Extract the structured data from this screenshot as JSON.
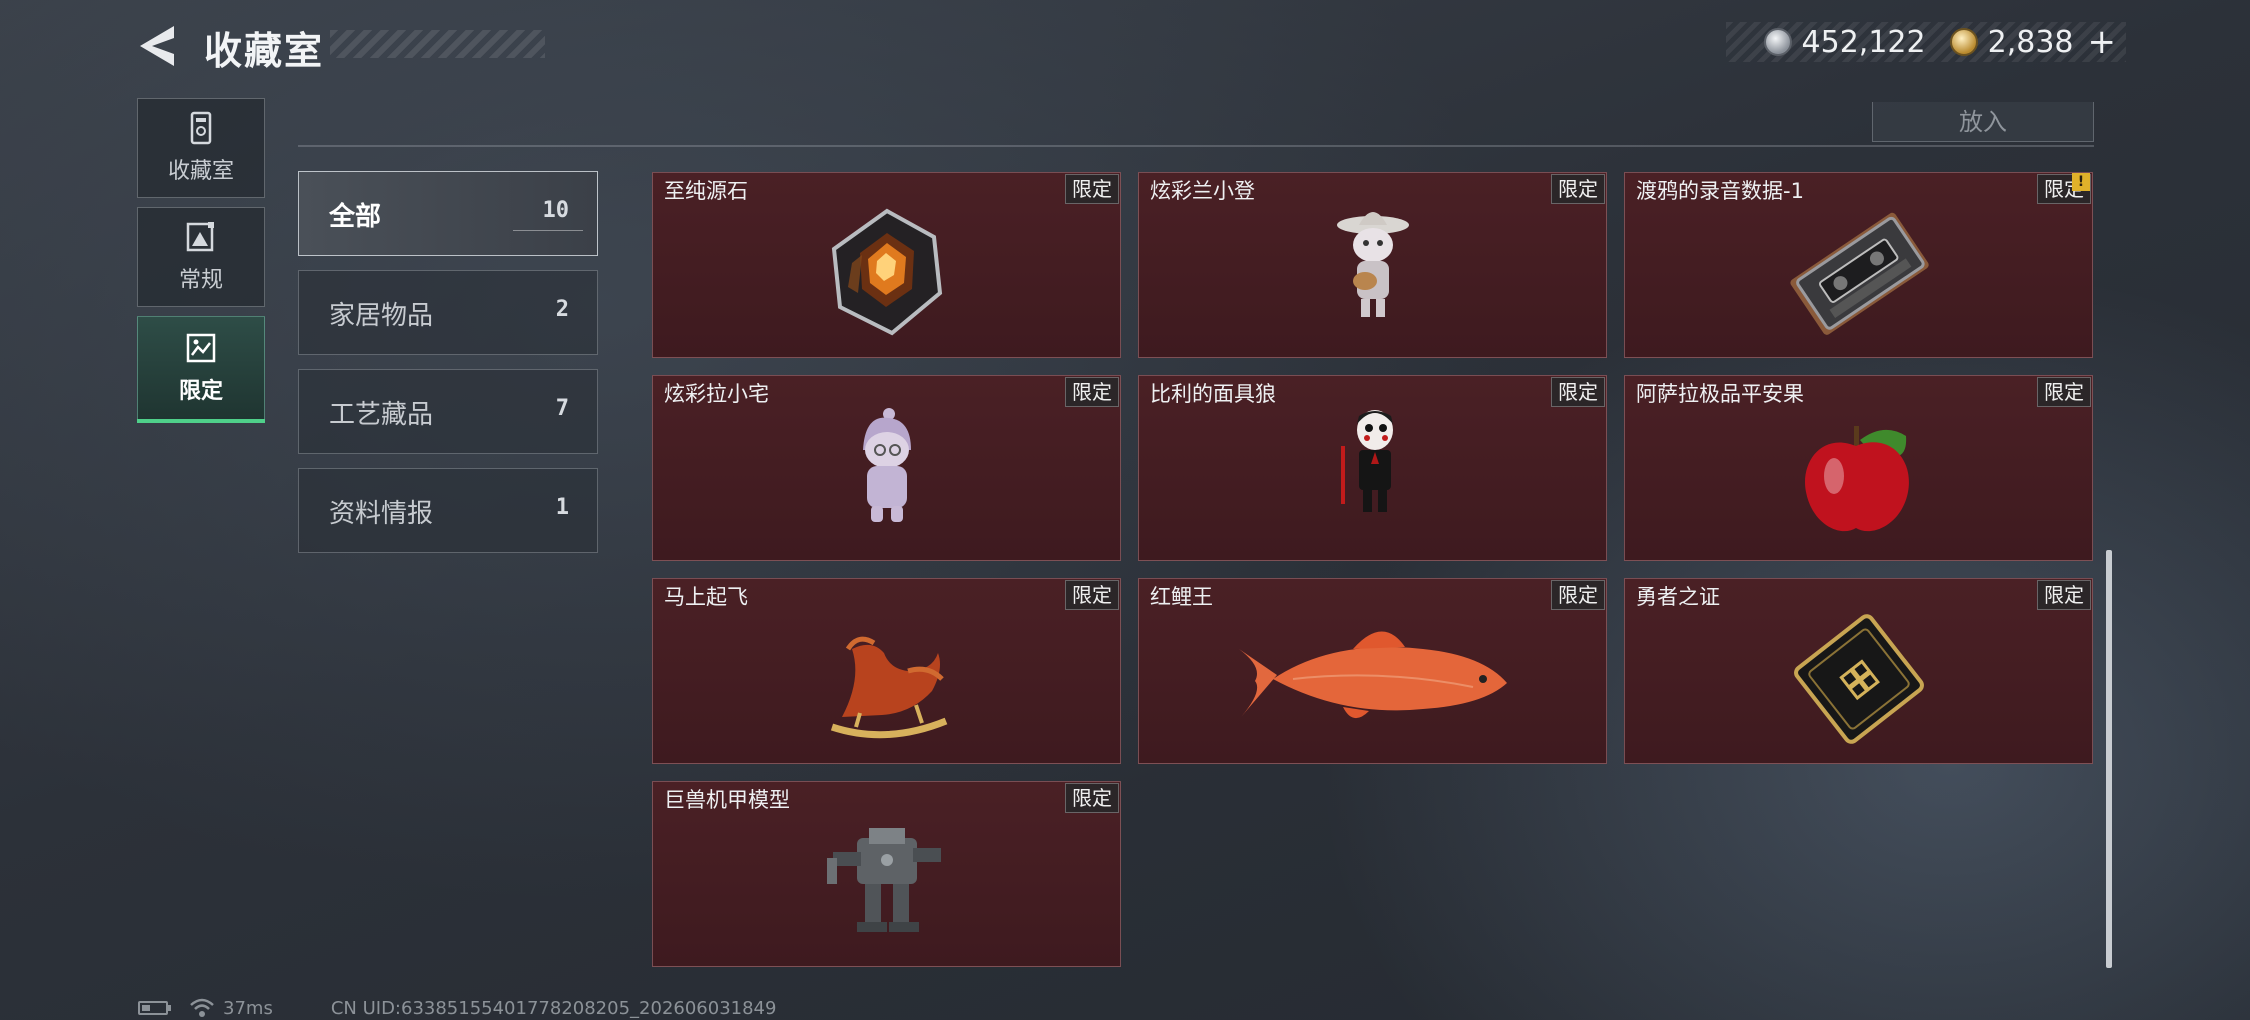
{
  "header": {
    "title": "收藏室",
    "back_icon": "back-arrow-icon",
    "currency": [
      {
        "icon": "silver-coin-icon",
        "value": "452,122"
      },
      {
        "icon": "gold-coin-icon",
        "value": "2,838"
      }
    ],
    "add_label": "+"
  },
  "nav": {
    "tabs": [
      {
        "label": "收藏室",
        "icon": "trophy-room-icon"
      },
      {
        "label": "常规",
        "icon": "image-frame-icon"
      },
      {
        "label": "限定",
        "icon": "limited-image-icon",
        "active": true
      }
    ]
  },
  "toolbar": {
    "put_in_label": "放入"
  },
  "filters": [
    {
      "label": "全部",
      "count": "10",
      "active": true
    },
    {
      "label": "家居物品",
      "count": "2"
    },
    {
      "label": "工艺藏品",
      "count": "7"
    },
    {
      "label": "资料情报",
      "count": "1"
    }
  ],
  "items": [
    {
      "name": "至纯源石",
      "tag": "限定",
      "art": "crystal-gem-icon"
    },
    {
      "name": "炫彩兰小登",
      "tag": "限定",
      "art": "sombrero-figurine-icon"
    },
    {
      "name": "渡鸦的录音数据-1",
      "tag": "限定",
      "art": "cassette-tape-icon",
      "warning": "!"
    },
    {
      "name": "炫彩拉小宅",
      "tag": "限定",
      "art": "hooded-figurine-icon"
    },
    {
      "name": "比利的面具狼",
      "tag": "限定",
      "art": "puppet-figure-icon"
    },
    {
      "name": "阿萨拉极品平安果",
      "tag": "限定",
      "art": "red-apple-icon"
    },
    {
      "name": "马上起飞",
      "tag": "限定",
      "art": "rocking-horse-icon"
    },
    {
      "name": "红鲤王",
      "tag": "限定",
      "art": "red-carp-icon"
    },
    {
      "name": "勇者之证",
      "tag": "限定",
      "art": "black-gold-card-icon"
    },
    {
      "name": "巨兽机甲模型",
      "tag": "限定",
      "art": "mech-model-icon"
    }
  ],
  "status": {
    "ping": "37ms",
    "uid": "CN UID:633851554017782082​05_202606031849"
  }
}
